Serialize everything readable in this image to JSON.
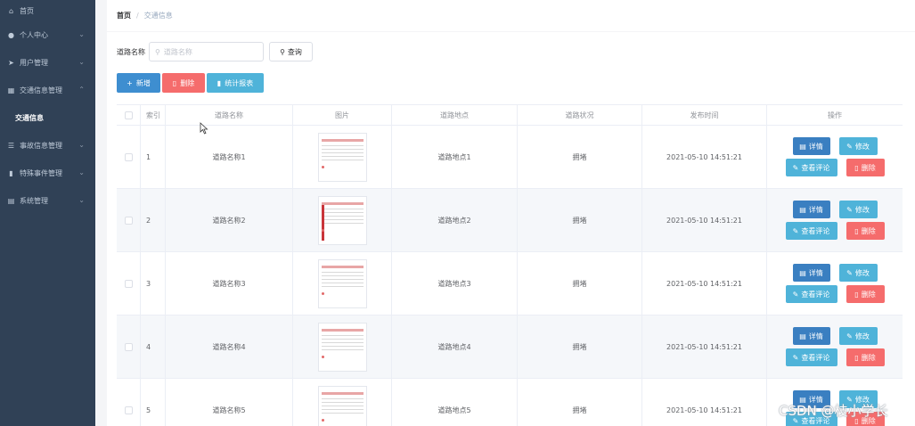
{
  "sidebar": {
    "items": [
      {
        "label": "首页",
        "icon": "home-icon"
      },
      {
        "label": "个人中心",
        "icon": "user-icon"
      },
      {
        "label": "用户管理",
        "icon": "send-icon"
      },
      {
        "label": "交通信息管理",
        "icon": "grid-icon"
      },
      {
        "label": "交通信息",
        "icon": ""
      },
      {
        "label": "事故信息管理",
        "icon": "list-icon"
      },
      {
        "label": "特殊事件管理",
        "icon": "bar-chart-icon"
      },
      {
        "label": "系统管理",
        "icon": "document-icon"
      }
    ]
  },
  "breadcrumb": {
    "home": "首页",
    "separator": "/",
    "current": "交通信息"
  },
  "search": {
    "label": "道路名称",
    "placeholder": "道路名称",
    "button": "查询"
  },
  "actions": {
    "add": "新增",
    "delete": "删除",
    "report": "统计报表"
  },
  "table": {
    "headers": [
      "索引",
      "道路名称",
      "图片",
      "道路地点",
      "道路状况",
      "发布时间",
      "操作"
    ],
    "rows": [
      {
        "index": "1",
        "name": "道路名称1",
        "location": "道路地点1",
        "status": "拥堵",
        "time": "2021-05-10 14:51:21"
      },
      {
        "index": "2",
        "name": "道路名称2",
        "location": "道路地点2",
        "status": "拥堵",
        "time": "2021-05-10 14:51:21"
      },
      {
        "index": "3",
        "name": "道路名称3",
        "location": "道路地点3",
        "status": "拥堵",
        "time": "2021-05-10 14:51:21"
      },
      {
        "index": "4",
        "name": "道路名称4",
        "location": "道路地点4",
        "status": "拥堵",
        "time": "2021-05-10 14:51:21"
      },
      {
        "index": "5",
        "name": "道路名称5",
        "location": "道路地点5",
        "status": "拥堵",
        "time": "2021-05-10 14:51:21"
      }
    ],
    "row_actions": {
      "detail": "详情",
      "edit": "修改",
      "review": "查看评论",
      "remove": "删除"
    }
  },
  "watermark": "CSDN @枝小学长",
  "colors": {
    "sidebar": "#304156",
    "primary": "#3a7fc1",
    "info": "#4fb3d9",
    "danger": "#f56c6c"
  }
}
